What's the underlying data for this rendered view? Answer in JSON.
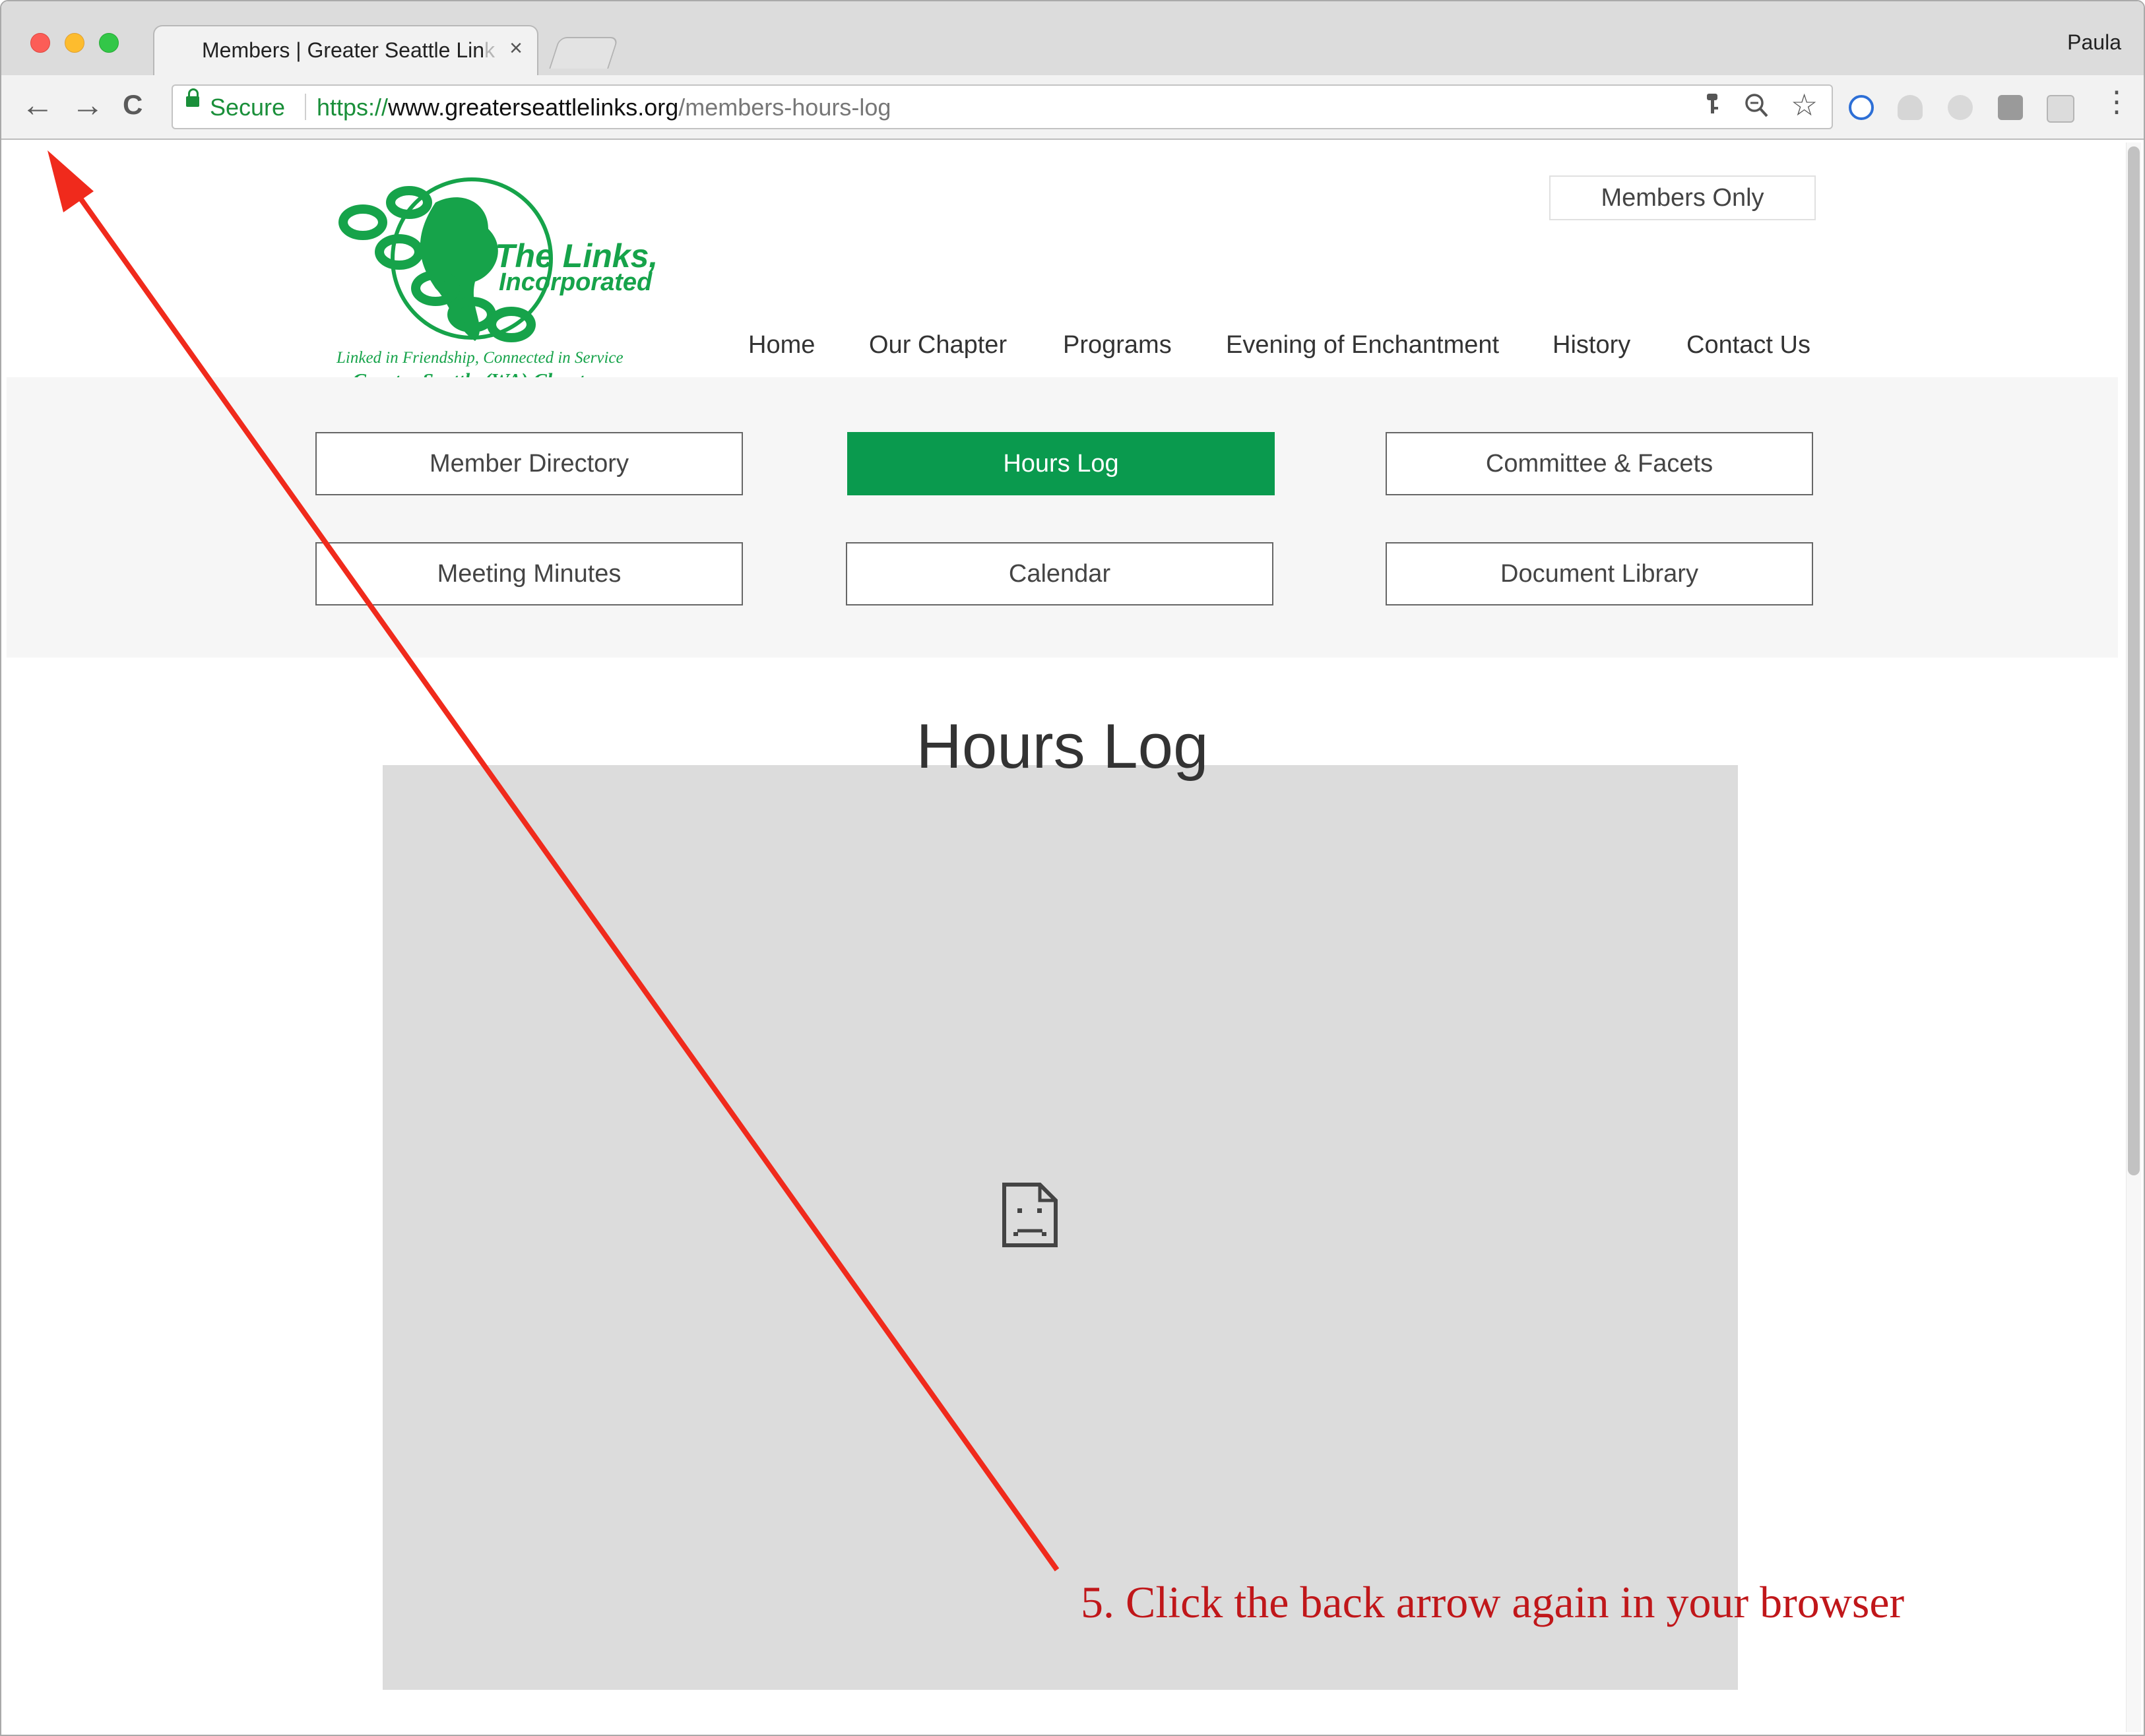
{
  "browser": {
    "tab": {
      "title": "Members | Greater Seattle Lin",
      "title_fade": "k",
      "close": "×"
    },
    "profile": "Paula",
    "nav": {
      "back": "←",
      "forward": "→",
      "reload": "C"
    },
    "address": {
      "secure_label": "Secure",
      "scheme": "https://",
      "host": "www.greaterseattlelinks.org",
      "path": "/members-hours-log"
    }
  },
  "site": {
    "logo": {
      "title": "The Links,",
      "subtitle": "Incorporated",
      "tagline": "Linked in Friendship, Connected in Service",
      "chapter": "Greater Seattle (WA) Chapter"
    },
    "members_only": "Members Only",
    "nav": [
      "Home",
      "Our Chapter",
      "Programs",
      "Evening of Enchantment",
      "History",
      "Contact Us"
    ],
    "member_menu": [
      {
        "label": "Member Directory",
        "active": false
      },
      {
        "label": "Hours Log",
        "active": true
      },
      {
        "label": "Committee & Facets",
        "active": false
      },
      {
        "label": "Meeting Minutes",
        "active": false
      },
      {
        "label": "Calendar",
        "active": false
      },
      {
        "label": "Document Library",
        "active": false
      }
    ],
    "page_title": "Hours Log"
  },
  "annotation": {
    "text": "5. Click the back arrow again in your browser",
    "color": "#e8271a"
  },
  "colors": {
    "brand_green": "#0a9a4e",
    "annotation_red": "#c0171a"
  }
}
